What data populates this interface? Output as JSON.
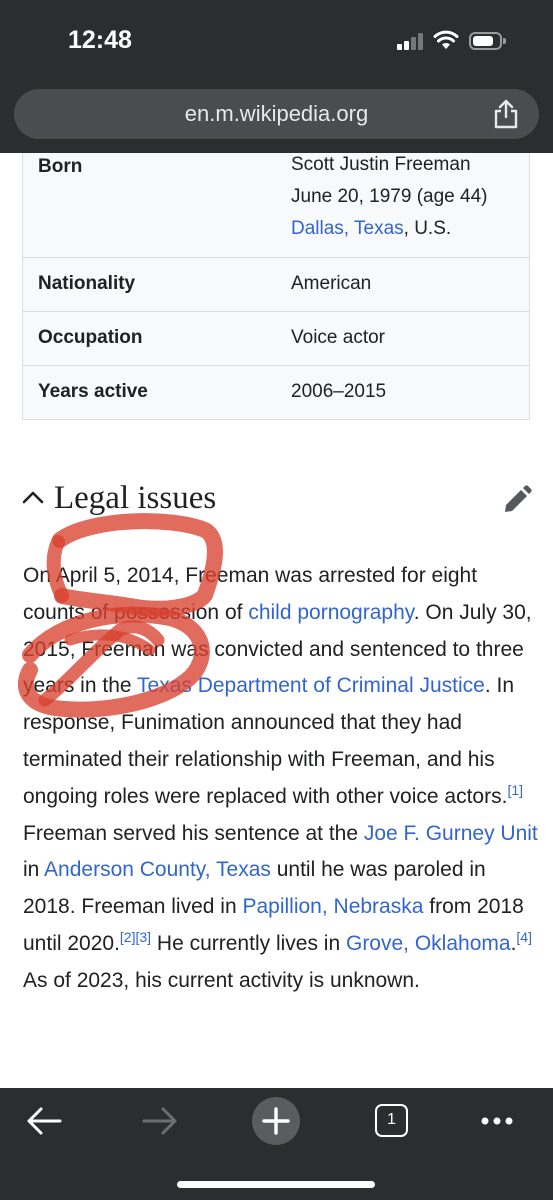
{
  "status_bar": {
    "time": "12:48"
  },
  "browser": {
    "url": "en.m.wikipedia.org"
  },
  "infobox": {
    "born_label": "Born",
    "born_name": "Scott Justin Freeman",
    "born_date": "June 20, 1979 (age 44)",
    "born_place_link": "Dallas, Texas",
    "born_place_suffix": ", U.S.",
    "nationality_label": "Nationality",
    "nationality_value": "American",
    "occupation_label": "Occupation",
    "occupation_value": "Voice actor",
    "years_label": "Years active",
    "years_value": "2006–2015"
  },
  "section": {
    "title": "Legal issues"
  },
  "paragraph": {
    "t1": "On April 5, 2014, Freeman was arrested for eight counts of possession of ",
    "l1": "child pornography",
    "t2": ". On July 30, 2015, Freeman was convicted and sentenced to three years in the ",
    "l2": "Texas Department of Criminal Justice",
    "t3": ". In response, Funimation announced that they had terminated their relationship with Freeman, and his ongoing roles were replaced with other voice actors.",
    "r1": "[1]",
    "t4": " Freeman served his sentence at the ",
    "l3": "Joe F. Gurney Unit",
    "t5": " in ",
    "l4": "Anderson County, Texas",
    "t6": " until he was paroled in 2018. Freeman lived in ",
    "l5": "Papillion, Nebraska",
    "t7": " from 2018 until 2020.",
    "r2": "[2]",
    "r3": "[3]",
    "t8": " He currently lives in ",
    "l6": "Grove, Oklahoma",
    "t9": ".",
    "r4": "[4]",
    "t10": " As of 2023, his current activity is unknown."
  },
  "toolbar": {
    "tab_count": "1"
  },
  "colors": {
    "link": "#3366cc",
    "scribble": "#d8412f",
    "chrome": "#2b2d2f"
  }
}
